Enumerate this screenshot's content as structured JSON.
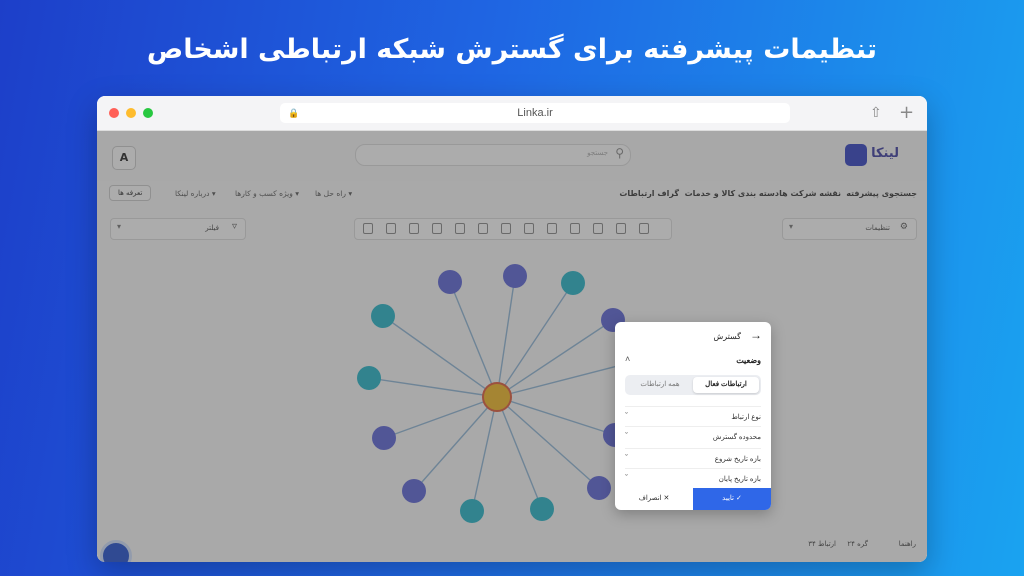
{
  "headline": "تنظیمات پیشرفته برای گسترش شبکه ارتباطی اشخاص",
  "browser": {
    "url": "Linka.ir"
  },
  "app": {
    "logo": "لینکا",
    "user_initial": "A",
    "search_placeholder": "جستجو",
    "menu": [
      "جستجوی پیشرفته",
      "نقشه شرکت ها",
      "دسته بندی کالا و خدمات",
      "گراف ارتباطات"
    ],
    "dropdowns": [
      "درباره لینکا",
      "ویژه کسب و کارها",
      "راه حل ها"
    ],
    "pill": "تعرفه ها",
    "filter_label": "فیلتر",
    "settings_label": "تنظیمات",
    "status": {
      "edges": "ارتباط ۳۴",
      "nodes": "گره ۲۴",
      "guide": "راهنما"
    }
  },
  "panel": {
    "title": "گسترش",
    "status_section": "وضعیت",
    "seg_active": "ارتباطات فعال",
    "seg_inactive": "همه ارتباطات",
    "rows": [
      "نوع ارتباط",
      "محدوده گسترش",
      "بازه تاریخ شروع",
      "بازه تاریخ پایان"
    ],
    "confirm": "تایید",
    "cancel": "انصراف"
  },
  "colors": {
    "accent": "#2f67e8",
    "person_node": "#22b5c9",
    "company_node": "#5a63d8",
    "center_node": "#f2b824"
  }
}
